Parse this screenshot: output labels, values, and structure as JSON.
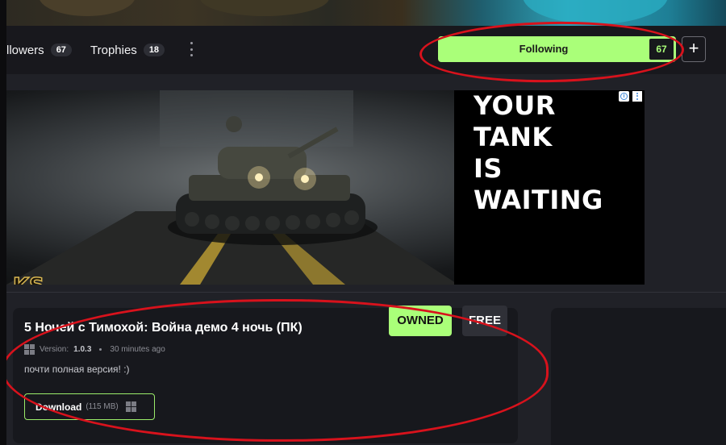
{
  "profile": {
    "followers_label": "llowers",
    "followers_count": "67",
    "trophies_label": "Trophies",
    "trophies_count": "18",
    "follow_button": {
      "label": "Following",
      "count": "67"
    },
    "plus_button_label": "+"
  },
  "ad": {
    "headline_line1": "YOUR TANK",
    "headline_line2": "IS WAITING",
    "logo_fragment": "KS",
    "info_icon": "i"
  },
  "game": {
    "title": "5 Ночей с Тимохой: Война демо 4 ночь (ПК)",
    "owned_badge": "OWNED",
    "price_badge": "FREE",
    "platform_icon": "windows-icon",
    "version_label": "Version:",
    "version": "1.0.3",
    "updated": "30 minutes ago",
    "description": "почти полная версия! :)",
    "download_label": "Download",
    "download_size": "(115 MB)"
  },
  "colors": {
    "accent_green": "#aaff79",
    "annotation_red": "#d8121c",
    "background": "#202127"
  }
}
